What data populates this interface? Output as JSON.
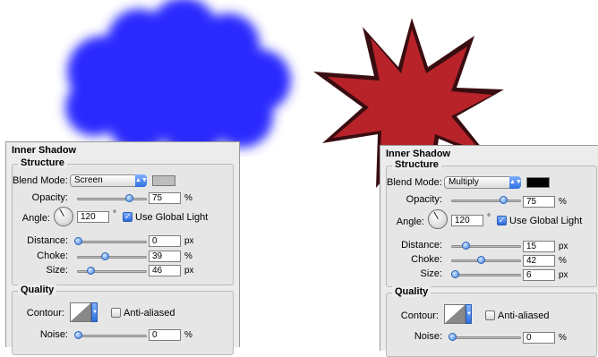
{
  "colors": {
    "cloud": "#2a2aff",
    "star": "#b8232a",
    "star_shadow": "#3a0d10",
    "accent": "#3f83ea"
  },
  "panels": [
    {
      "title": "Inner Shadow",
      "structure_title": "Structure",
      "blend_mode_label": "Blend Mode:",
      "blend_mode_value": "Screen",
      "swatch_color": "#bdbdbd",
      "opacity_label": "Opacity:",
      "opacity_value": "75",
      "opacity_unit": "%",
      "opacity_level": 0.75,
      "angle_label": "Angle:",
      "angle_value": "120",
      "angle_unit": "°",
      "global_light_label": "Use Global Light",
      "global_light_checked": true,
      "distance_label": "Distance:",
      "distance_value": "0",
      "distance_unit": "px",
      "distance_level": 0.0,
      "choke_label": "Choke:",
      "choke_value": "39",
      "choke_unit": "%",
      "choke_level": 0.39,
      "size_label": "Size:",
      "size_value": "46",
      "size_unit": "px",
      "size_level": 0.18,
      "quality_title": "Quality",
      "contour_label": "Contour:",
      "anti_aliased_label": "Anti-aliased",
      "noise_label": "Noise:",
      "noise_value": "0",
      "noise_unit": "%",
      "noise_level": 0.0
    },
    {
      "title": "Inner Shadow",
      "structure_title": "Structure",
      "blend_mode_label": "Blend Mode:",
      "blend_mode_value": "Multiply",
      "swatch_color": "#000000",
      "opacity_label": "Opacity:",
      "opacity_value": "75",
      "opacity_unit": "%",
      "opacity_level": 0.75,
      "angle_label": "Angle:",
      "angle_value": "120",
      "angle_unit": "°",
      "global_light_label": "Use Global Light",
      "global_light_checked": true,
      "distance_label": "Distance:",
      "distance_value": "15",
      "distance_unit": "px",
      "distance_level": 0.2,
      "choke_label": "Choke:",
      "choke_value": "42",
      "choke_unit": "%",
      "choke_level": 0.42,
      "size_label": "Size:",
      "size_value": "6",
      "size_unit": "px",
      "size_level": 0.04,
      "quality_title": "Quality",
      "contour_label": "Contour:",
      "anti_aliased_label": "Anti-aliased",
      "noise_label": "Noise:",
      "noise_value": "0",
      "noise_unit": "%",
      "noise_level": 0.0
    }
  ]
}
